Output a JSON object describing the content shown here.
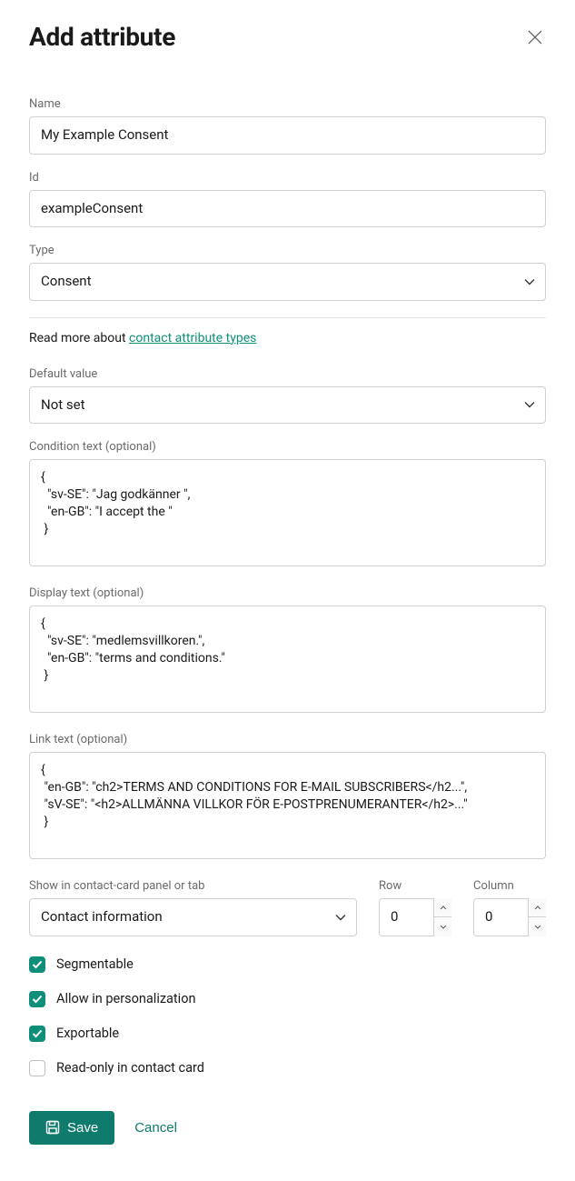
{
  "title": "Add attribute",
  "fields": {
    "name": {
      "label": "Name",
      "value": "My Example Consent"
    },
    "id": {
      "label": "Id",
      "value": "exampleConsent"
    },
    "type": {
      "label": "Type",
      "value": "Consent"
    },
    "defaultValue": {
      "label": "Default value",
      "value": "Not set"
    },
    "conditionText": {
      "label": "Condition text (optional)",
      "value": "{\n  \"sv-SE\": \"Jag godkänner \",\n  \"en-GB\": \"I accept the \"\n }"
    },
    "displayText": {
      "label": "Display text (optional)",
      "value": "{\n  \"sv-SE\": \"medlemsvillkoren.\",\n  \"en-GB\": \"terms and conditions.\"\n }"
    },
    "linkText": {
      "label": "Link text (optional)",
      "value": "{\n \"en-GB\": \"ch2>TERMS AND CONDITIONS FOR E-MAIL SUBSCRIBERS</h2...\",\n \"sV-SE\": \"<h2>ALLMÄNNA VILLKOR FÖR E-POSTPRENUMERANTER</h2>...\"\n }"
    },
    "showIn": {
      "label": "Show in contact-card panel or tab",
      "value": "Contact information"
    },
    "row": {
      "label": "Row",
      "value": "0"
    },
    "column": {
      "label": "Column",
      "value": "0"
    }
  },
  "readMore": {
    "prefix": "Read more about ",
    "link": "contact attribute types"
  },
  "checkboxes": {
    "segmentable": {
      "label": "Segmentable",
      "checked": true
    },
    "personalization": {
      "label": "Allow in personalization",
      "checked": true
    },
    "exportable": {
      "label": "Exportable",
      "checked": true
    },
    "readonly": {
      "label": "Read-only in contact card",
      "checked": false
    }
  },
  "actions": {
    "save": "Save",
    "cancel": "Cancel"
  }
}
